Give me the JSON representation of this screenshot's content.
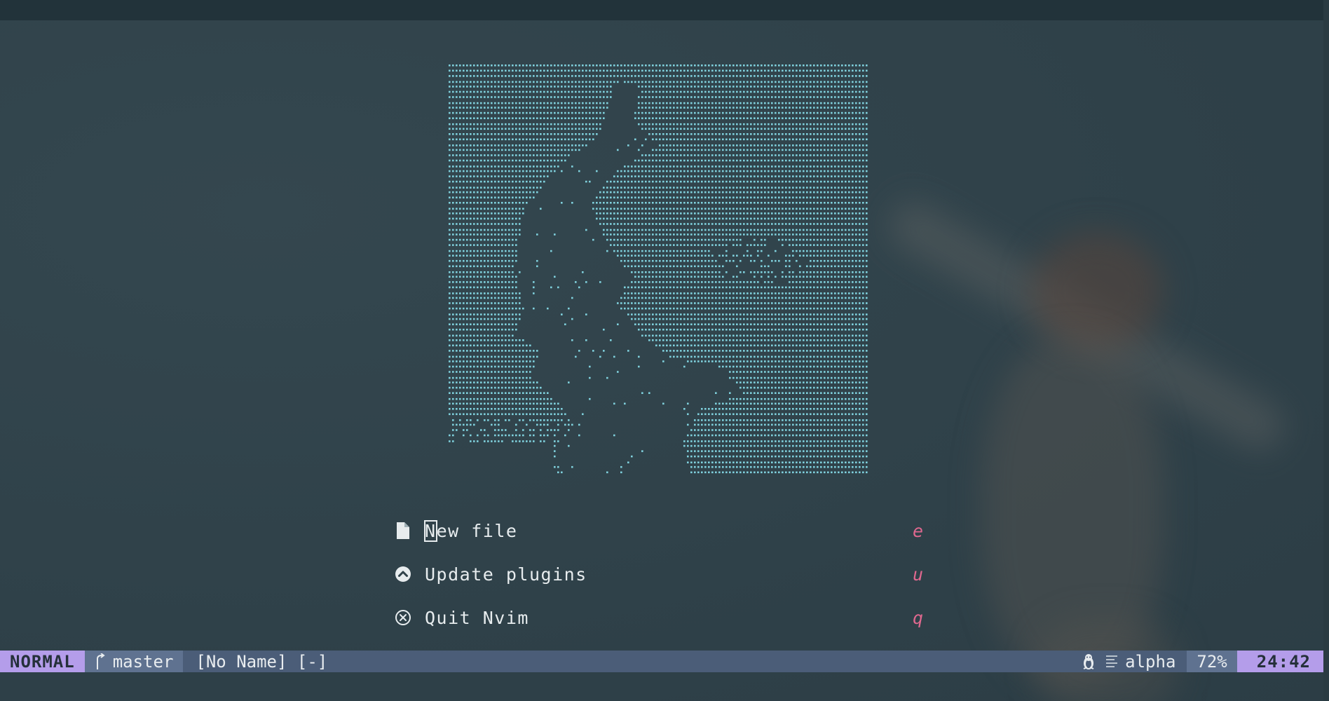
{
  "theme": {
    "background": "#2f4149",
    "accent_mode": "#b49dea",
    "shortcut_color": "#e0688f",
    "art_color": "#7fd0dc",
    "statusline_bg": "#4b5d78"
  },
  "dashboard": {
    "buttons": [
      {
        "icon": "file-icon",
        "label_first": "N",
        "label_rest": "ew file",
        "shortcut": "e"
      },
      {
        "icon": "chevron-up-circle-icon",
        "label": "Update plugins",
        "shortcut": "u"
      },
      {
        "icon": "close-circle-icon",
        "label": "Quit Nvim",
        "shortcut": "q"
      }
    ]
  },
  "statusline": {
    "mode": "NORMAL",
    "branch": "master",
    "filename": "[No Name] [-]",
    "os_icon": "linux-penguin-icon",
    "filetype_icon": "lines-icon",
    "filetype": "alpha",
    "percent": "72%",
    "clock": "24:42"
  }
}
